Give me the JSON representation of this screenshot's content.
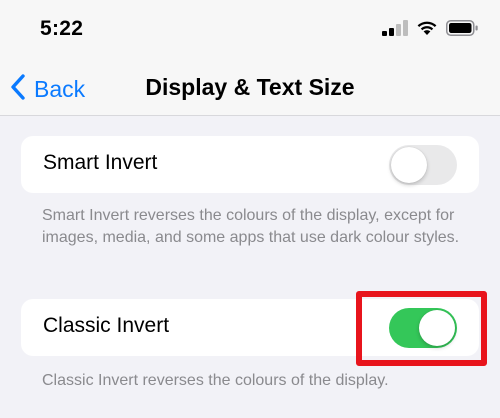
{
  "status_bar": {
    "time": "5:22",
    "icons": [
      "cellular-signal-icon",
      "wifi-icon",
      "battery-icon"
    ]
  },
  "nav": {
    "back_label": "Back",
    "title": "Display & Text Size"
  },
  "settings": {
    "smart_invert": {
      "label": "Smart Invert",
      "enabled": false,
      "footer": "Smart Invert reverses the colours of the display, except for images, media, and some apps that use dark colour styles."
    },
    "classic_invert": {
      "label": "Classic Invert",
      "enabled": true,
      "footer": "Classic Invert reverses the colours of the display."
    }
  },
  "colors": {
    "accent": "#0a7aff",
    "toggle_on": "#34c759",
    "toggle_off": "#e9e9ea",
    "highlight": "#e8141c",
    "background": "#f2f2f7"
  }
}
